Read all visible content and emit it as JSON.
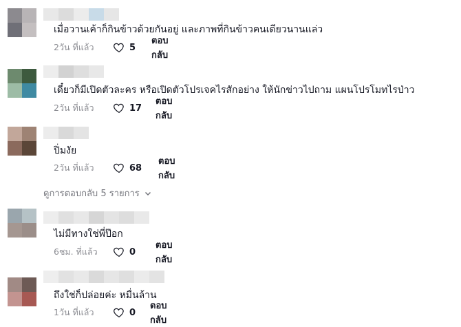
{
  "comments": [
    {
      "text": "เมื่อวานเค้าก็กินข้าวด้วยกันอยู่ และภาพที่กินข้าวคนเดียวนานแล่ว",
      "time": "2วัน ที่แล้ว",
      "likes": "5",
      "reply": "ตอบกลับ",
      "avatar_colors": [
        "#8c8a8f",
        "#b8b4b6",
        "#6f6f77",
        "#c4bfc0"
      ]
    },
    {
      "text": "เดี๋ยวก็มีเปิดตัวละคร หรือเปิดตัวโปรเจคไรสักอย่าง ให้นักข่าวไปถาม แผนโปรโมทไรป่าว",
      "time": "2วัน ที่แล้ว",
      "likes": "17",
      "reply": "ตอบกลับ",
      "avatar_colors": [
        "#6d8a6e",
        "#3d5a3e",
        "#9dbca6",
        "#3f8aa2"
      ]
    },
    {
      "text": "ปิ่มงัย",
      "time": "2วัน ที่แล้ว",
      "likes": "68",
      "reply": "ตอบกลับ",
      "avatar_colors": [
        "#c2a79a",
        "#9e8374",
        "#8b6a5d",
        "#5b4638"
      ]
    },
    {
      "text": "ไม่มีทางใช่พี่ป๊อก",
      "time": "6ชม. ที่แล้ว",
      "likes": "0",
      "reply": "ตอบกลับ",
      "avatar_colors": [
        "#9aa6ad",
        "#b5c2c6",
        "#a59791",
        "#9b8e89"
      ]
    },
    {
      "text": "ถึงใช่ก็ปล่อยค่ะ หมื่นล้าน",
      "time": "1วัน ที่แล้ว",
      "likes": "0",
      "reply": "ตอบกลับ",
      "avatar_colors": [
        "#a18a85",
        "#6d5a55",
        "#c39490",
        "#a75953"
      ]
    }
  ],
  "view_replies": "ดูการตอบกลับ 5 รายการ"
}
